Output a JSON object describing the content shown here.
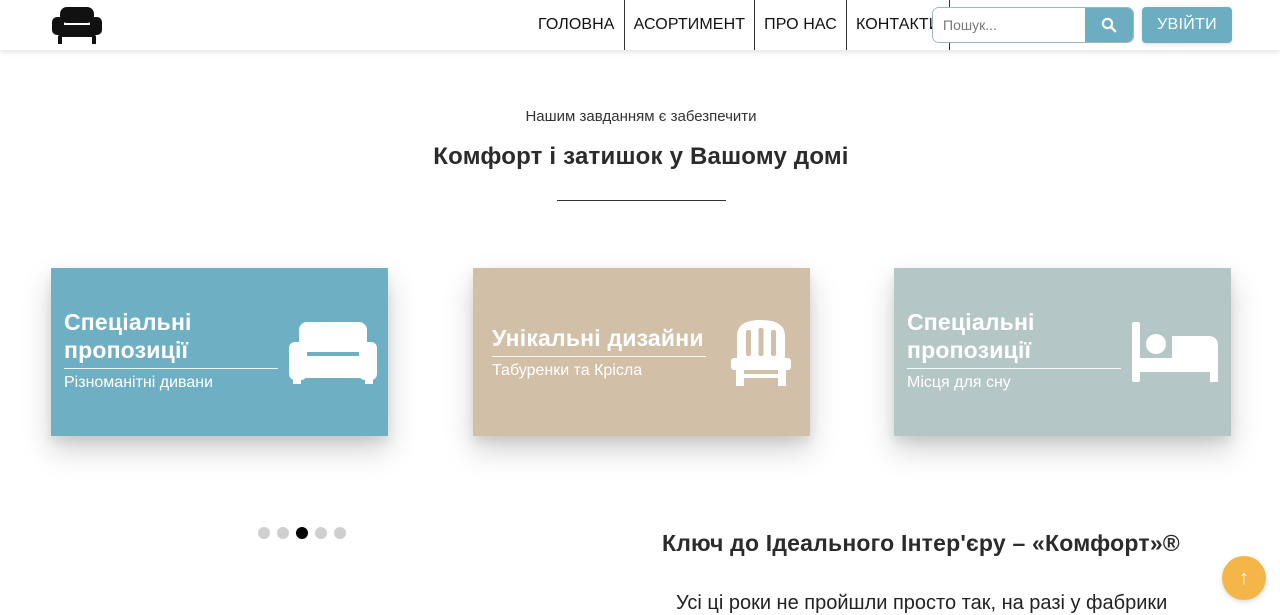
{
  "header": {
    "logo_icon": "armchair-icon",
    "nav": [
      {
        "label": "ГОЛОВНА"
      },
      {
        "label": "АСОРТИМЕНТ"
      },
      {
        "label": "ПРО НАС"
      },
      {
        "label": "КОНТАКТИ"
      }
    ],
    "search": {
      "placeholder": "Пошук...",
      "value": "",
      "icon": "search-icon"
    },
    "login_label": "УВІЙТИ"
  },
  "intro": {
    "subtitle": "Нашим завданням є забезпечити",
    "title": "Комфорт і затишок у Вашому домі"
  },
  "cards": [
    {
      "title": "Спеціальні пропозиції",
      "subtitle": "Різноманітні дивани",
      "icon": "sofa-icon",
      "color": "#6fafc3"
    },
    {
      "title": "Унікальні дизайни",
      "subtitle": "Табуренки та Крісла",
      "icon": "chair-icon",
      "color": "#d2bfa7"
    },
    {
      "title": "Спеціальні пропозиції",
      "subtitle": "Місця для сну",
      "icon": "bed-icon",
      "color": "#b5c6c6"
    }
  ],
  "carousel": {
    "dot_count": 5,
    "active_index": 2
  },
  "about": {
    "title": "Ключ до Ідеального Інтер'єру – «Комфорт»®",
    "body": "Усі ці роки не пройшли просто так, на разі у фабрики"
  },
  "scroll_top": {
    "label": "↑",
    "color": "#f5b649"
  },
  "colors": {
    "accent": "#6dadc2",
    "text": "#222222"
  }
}
